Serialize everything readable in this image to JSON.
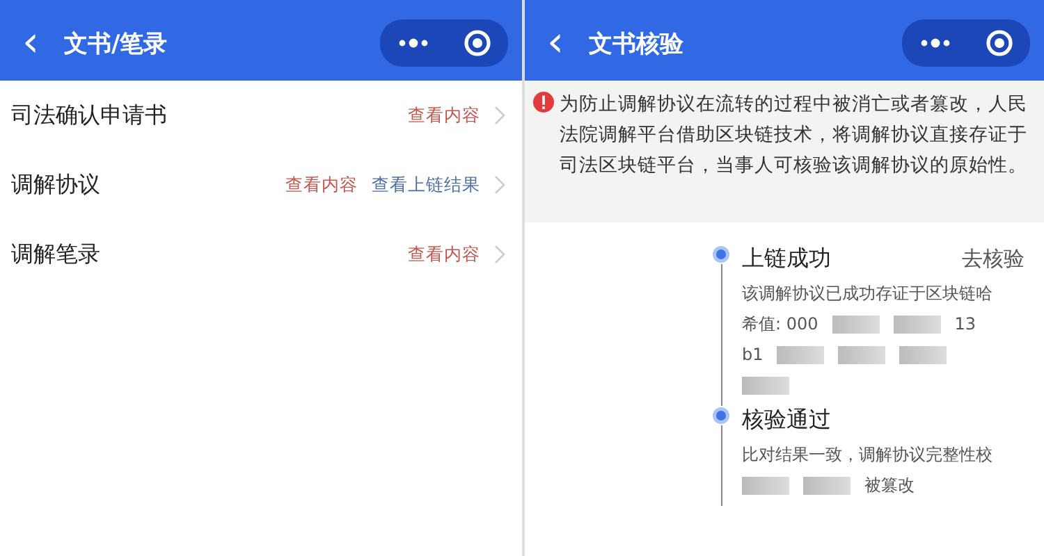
{
  "left_screen": {
    "title": "文书/笔录",
    "back": "‹",
    "rows": [
      {
        "label": "司法确认申请书",
        "links": [
          {
            "text": "查看内容",
            "kind": "content"
          }
        ]
      },
      {
        "label": "调解协议",
        "links": [
          {
            "text": "查看内容",
            "kind": "content"
          },
          {
            "text": "查看上链结果",
            "kind": "chain"
          }
        ]
      },
      {
        "label": "调解笔录",
        "links": [
          {
            "text": "查看内容",
            "kind": "content"
          }
        ]
      }
    ]
  },
  "right_screen": {
    "title": "文书核验",
    "back": "‹",
    "notice": "为防止调解协议在流转的过程中被消亡或者篡改，人民法院调解平台借助区块链技术，将调解协议直接存证于司法区块链平台，当事人可核验该调解协议的原始性。",
    "steps": [
      {
        "title": "上链成功",
        "action": "去核验",
        "lines": [
          [
            {
              "kind": "text",
              "text": "该调解协议已成功存证于区块链哈"
            }
          ],
          [
            {
              "kind": "text",
              "text": "希值: 000"
            },
            {
              "kind": "redacted"
            },
            {
              "kind": "redacted"
            },
            {
              "kind": "text",
              "text": "13"
            }
          ],
          [
            {
              "kind": "text",
              "text": "b1"
            },
            {
              "kind": "redacted"
            },
            {
              "kind": "redacted"
            },
            {
              "kind": "redacted"
            }
          ],
          [
            {
              "kind": "redacted"
            }
          ]
        ]
      },
      {
        "title": "核验通过",
        "lines": [
          [
            {
              "kind": "text",
              "text": "比对结果一致，调解协议完整性校"
            }
          ],
          [
            {
              "kind": "redacted"
            },
            {
              "kind": "redacted"
            },
            {
              "kind": "text",
              "text": "被篡改"
            }
          ]
        ]
      }
    ]
  }
}
